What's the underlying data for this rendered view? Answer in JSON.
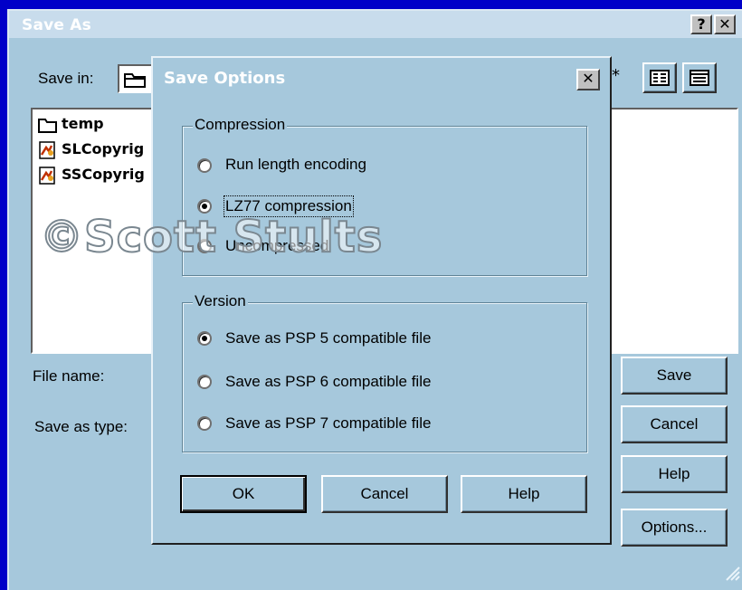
{
  "save_as": {
    "title": "Save As",
    "help_glyph": "?",
    "close_glyph": "✕",
    "save_in_label": "Save in:",
    "files": [
      "temp",
      "SLCopyrig",
      "SSCopyrig"
    ],
    "file_name_label": "File name:",
    "save_as_type_label": "Save as type:",
    "buttons": {
      "save": "Save",
      "cancel": "Cancel",
      "help": "Help",
      "options": "Options..."
    }
  },
  "save_options": {
    "title": "Save Options",
    "close_glyph": "✕",
    "compression": {
      "title": "Compression",
      "options": [
        {
          "label": "Run length encoding",
          "selected": false
        },
        {
          "label": "LZ77 compression",
          "selected": true
        },
        {
          "label": "Uncompressed",
          "selected": false
        }
      ]
    },
    "version": {
      "title": "Version",
      "options": [
        {
          "label": "Save as PSP 5 compatible file",
          "selected": true
        },
        {
          "label": "Save as PSP 6 compatible file",
          "selected": false
        },
        {
          "label": "Save as PSP 7 compatible file",
          "selected": false
        }
      ]
    },
    "buttons": {
      "ok": "OK",
      "cancel": "Cancel",
      "help": "Help"
    }
  },
  "watermark": "©Scott Stults",
  "colors": {
    "desktop": "#0000c8",
    "dialog": "#a6c8dc",
    "title_bar": "#c8dcec"
  }
}
